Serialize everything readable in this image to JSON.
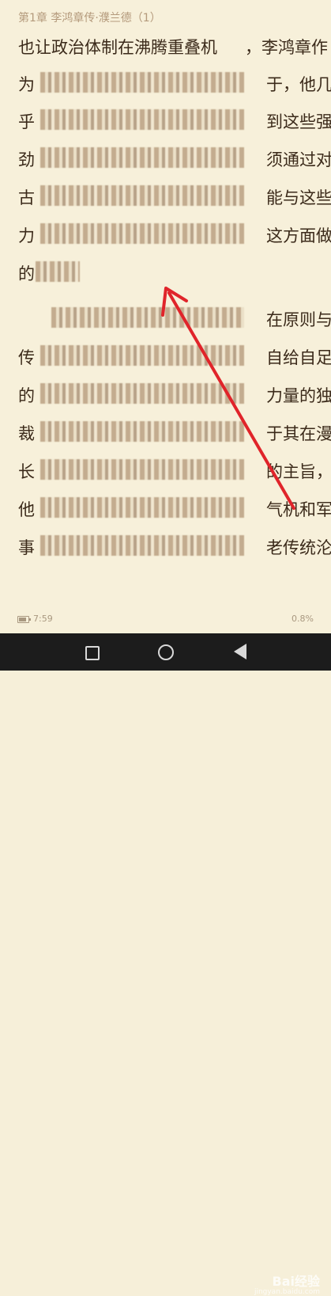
{
  "reader": {
    "chapter_title": "第1章 李鸿章传·濮兰德（1）",
    "lines": [
      {
        "a": "也让政治体制在沸腾重叠机",
        "b": "，李鸿章作"
      },
      {
        "a": "为",
        "b": "于，他几"
      },
      {
        "a": "乎",
        "b": "到这些强"
      },
      {
        "a": "劲",
        "b": "须通过对"
      },
      {
        "a": "古",
        "b": "能与这些"
      },
      {
        "a": "力",
        "b": "这方面做"
      },
      {
        "a": "的",
        "b": ""
      },
      {
        "a": "",
        "b": "在原则与"
      },
      {
        "a": "传",
        "b": "自给自足"
      },
      {
        "a": "的",
        "b": "力量的独"
      },
      {
        "a": "裁",
        "b": "于其在漫"
      },
      {
        "a": "长",
        "b": "的主旨，"
      },
      {
        "a": "他",
        "b": "气机和军"
      },
      {
        "a": "事",
        "b": "老传统沦"
      }
    ]
  },
  "status": {
    "time": "7:59",
    "progress": "0.8%",
    "battery_level": 0.8
  },
  "navbar": {
    "buttons": [
      "recent-apps",
      "home",
      "back"
    ]
  },
  "watermark": {
    "logo": "Bai经验",
    "url": "jingyan.baidu.com"
  },
  "annotation": {
    "arrow_color": "#e0242a"
  }
}
